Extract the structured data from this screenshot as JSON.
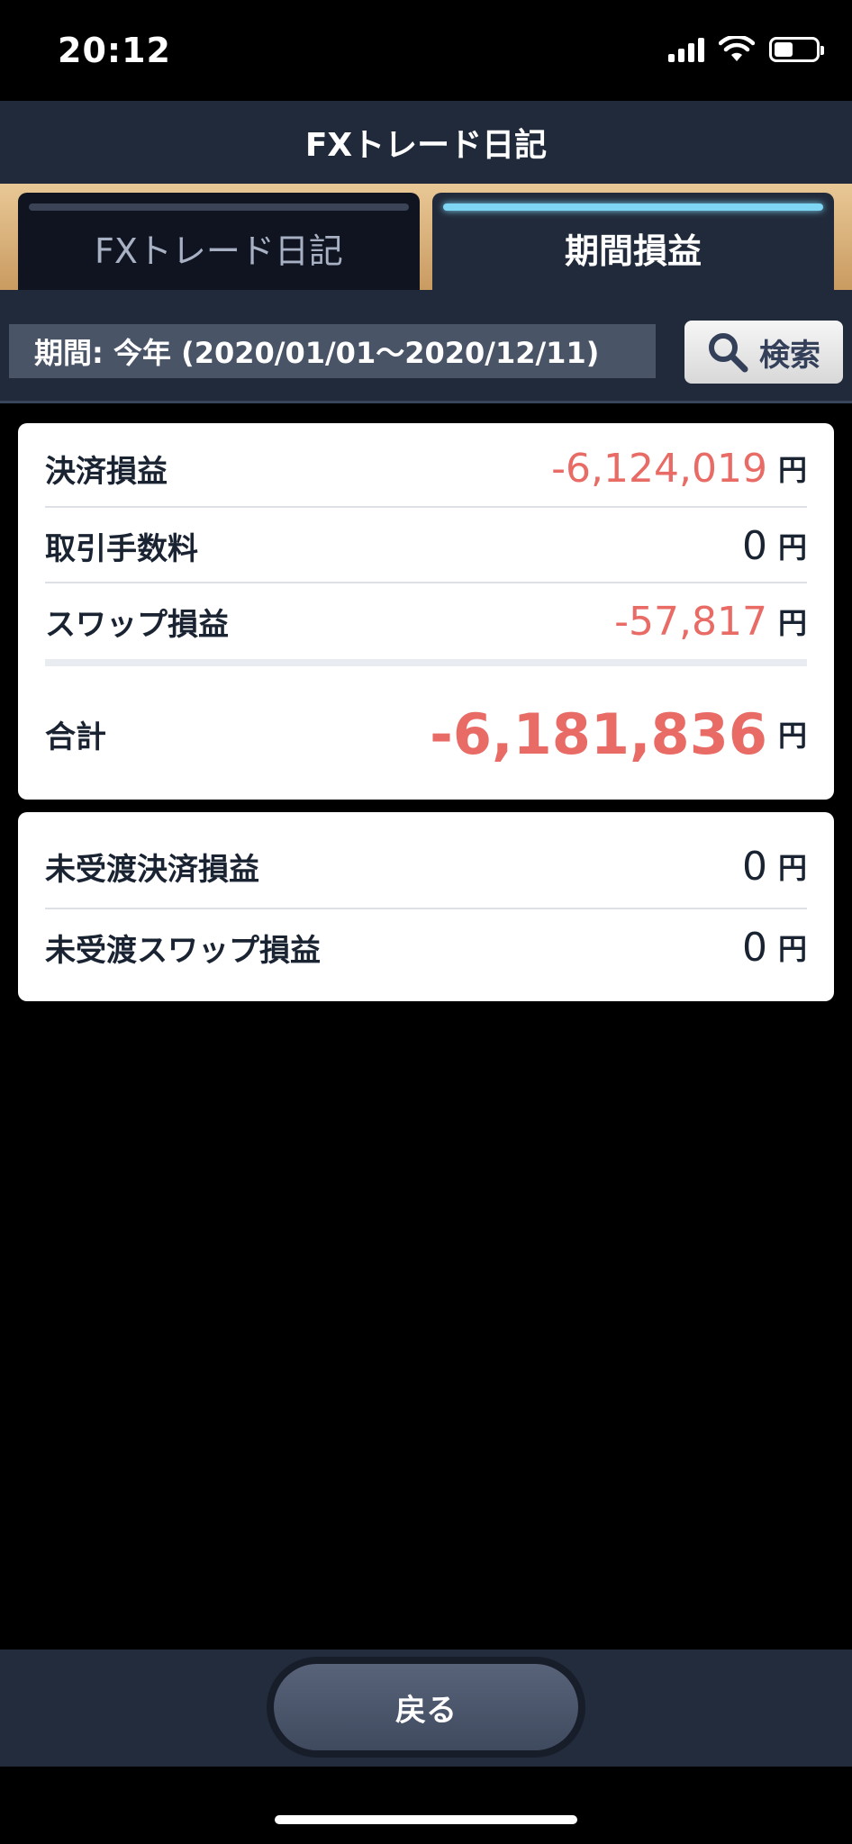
{
  "status_bar": {
    "time": "20:12"
  },
  "header": {
    "title": "FXトレード日記"
  },
  "tabs": [
    {
      "label": "FXトレード日記",
      "active": false
    },
    {
      "label": "期間損益",
      "active": true
    }
  ],
  "search": {
    "period_text": "期間: 今年 (2020/01/01〜2020/12/11)",
    "button_label": "検索"
  },
  "summary": {
    "rows": [
      {
        "label": "決済損益",
        "value": "-6,124,019",
        "unit": "円"
      },
      {
        "label": "取引手数料",
        "value": "0",
        "unit": "円"
      },
      {
        "label": "スワップ損益",
        "value": "-57,817",
        "unit": "円"
      }
    ],
    "total": {
      "label": "合計",
      "value": "-6,181,836",
      "unit": "円"
    }
  },
  "unsettled": {
    "rows": [
      {
        "label": "未受渡決済損益",
        "value": "0",
        "unit": "円"
      },
      {
        "label": "未受渡スワップ損益",
        "value": "0",
        "unit": "円"
      }
    ]
  },
  "footer": {
    "back_label": "戻る"
  },
  "colors": {
    "negative": "#e86b66",
    "navy": "#212a3a",
    "tab_accent": "#7fd6f4",
    "gold": "#e9c896"
  }
}
